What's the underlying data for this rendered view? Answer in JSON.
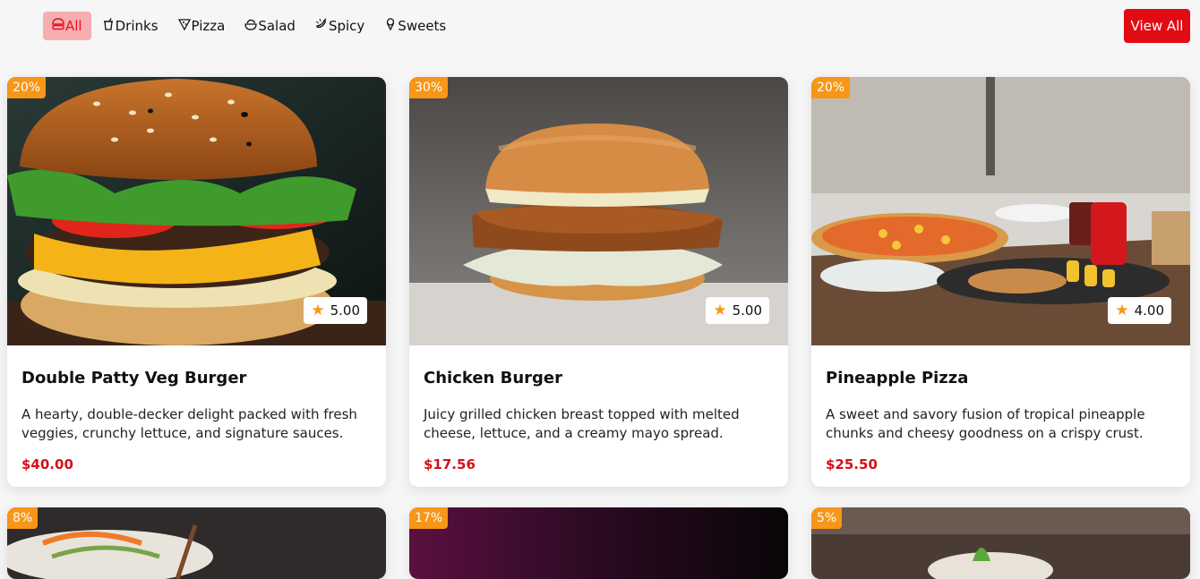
{
  "filters": [
    {
      "label": "All",
      "icon": "burger-icon"
    },
    {
      "label": "Drinks",
      "icon": "cup-icon"
    },
    {
      "label": "Pizza",
      "icon": "pizza-slice-icon"
    },
    {
      "label": "Salad",
      "icon": "salad-bowl-icon"
    },
    {
      "label": "Spicy",
      "icon": "chili-icon"
    },
    {
      "label": "Sweets",
      "icon": "ice-cream-icon"
    }
  ],
  "view_all_label": "View All",
  "products": [
    {
      "name": "Double Patty Veg Burger",
      "discount": "20%",
      "rating": "5.00",
      "description": "A hearty, double-decker delight packed with fresh veggies, crunchy lettuce, and signature sauces.",
      "price": "$40.00"
    },
    {
      "name": "Chicken Burger",
      "discount": "30%",
      "rating": "5.00",
      "description": "Juicy grilled chicken breast topped with melted cheese, lettuce, and a creamy mayo spread.",
      "price": "$17.56"
    },
    {
      "name": "Pineapple Pizza",
      "discount": "20%",
      "rating": "4.00",
      "description": "A sweet and savory fusion of tropical pineapple chunks and cheesy goodness on a crispy crust.",
      "price": "$25.50"
    },
    {
      "discount": "8%"
    },
    {
      "discount": "17%"
    },
    {
      "discount": "5%"
    }
  ],
  "colors": {
    "accent": "#e30b13",
    "badge": "#f79617",
    "active_bg": "#f7aeb1",
    "price": "#d2101a"
  }
}
